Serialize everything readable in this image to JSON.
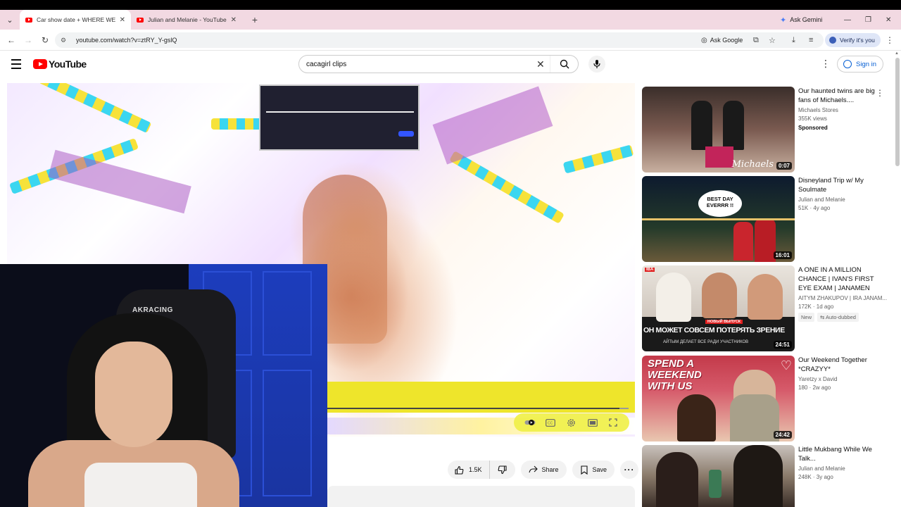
{
  "browser": {
    "tabs": [
      {
        "title": "Car show date + WHERE WE M",
        "active": true
      },
      {
        "title": "Julian and Melanie - YouTube",
        "active": false
      }
    ],
    "gemini_label": "Ask Gemini",
    "url": "youtube.com/watch?v=ztRY_Y-gslQ",
    "ask_google_label": "Ask Google",
    "verify_label": "Verify it's you"
  },
  "youtube": {
    "logo_text": "YouTube",
    "search_value": "cacagirl clips",
    "signin_label": "Sign in"
  },
  "video": {
    "progress_fraction": 0.97,
    "actions": {
      "like_count": "1.5K",
      "share_label": "Share",
      "save_label": "Save"
    }
  },
  "recommendations": [
    {
      "title": "Our haunted twins are big fans of Michaels....",
      "channel": "Michaels Stores",
      "meta": "355K views",
      "sponsored": "Sponsored",
      "duration": "0:07",
      "badges": []
    },
    {
      "title": "Disneyland Trip w/ My Soulmate",
      "channel": "Julian and Melanie",
      "meta": "51K · 4y ago",
      "sponsored": "",
      "duration": "16:01",
      "badges": []
    },
    {
      "title": "A ONE IN A MILLION CHANCE | IVAN'S FIRST EYE EXAM | JANAMEN",
      "channel": "AITYM ZHAKUPOV | IRA JANAM...",
      "meta": "172K · 1d ago",
      "sponsored": "",
      "duration": "24:51",
      "badges": [
        "New",
        "Auto-dubbed"
      ]
    },
    {
      "title": "Our Weekend Together *CRAZYY*",
      "channel": "Yaretzy x David",
      "meta": "180 · 2w ago",
      "sponsored": "",
      "duration": "24:42",
      "badges": []
    },
    {
      "title": "Little Mukbang While We Talk...",
      "channel": "Julian and Melanie",
      "meta": "248K · 3y ago",
      "sponsored": "",
      "duration": "",
      "badges": []
    }
  ],
  "thumb_texts": {
    "t1_watermark": "Michaels",
    "t2_bubble": "BEST DAY EVERRR !!",
    "t3_banner": "ОН МОЖЕТ СОВСЕМ ПОТЕРЯТЬ ЗРЕНИЕ",
    "t3_sub": "АЙТЫМ ДЕЛАЕТ ВСЕ РАДИ УЧАСТНИКОВ",
    "t3_tag": "IBA",
    "t3_tag2": "НОВЫЙ ВЫПУСК",
    "t4_text": "SPEND A WEEKEND WITH US"
  },
  "webcam": {
    "chair_brand": "AKRACING"
  },
  "colors": {
    "yt_red": "#ff0000",
    "link_blue": "#065fd4",
    "tab_bar": "#f2d9e2"
  }
}
